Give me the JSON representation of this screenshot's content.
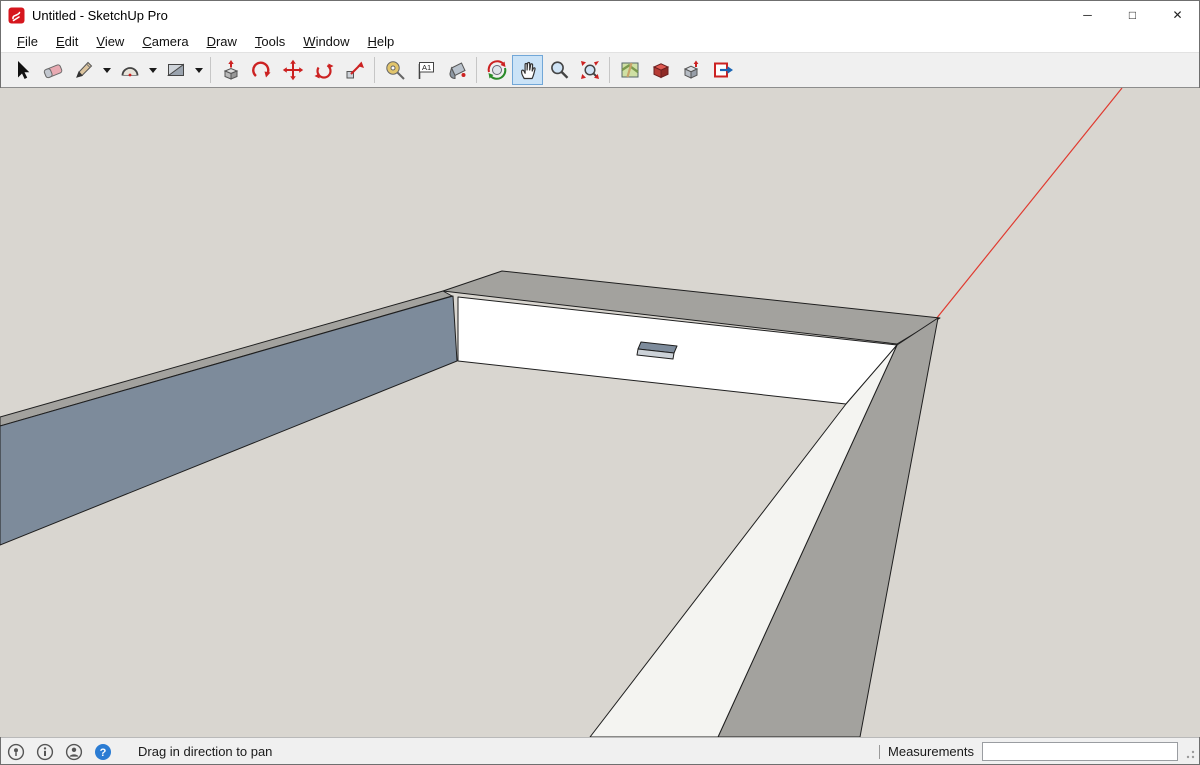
{
  "window": {
    "title": "Untitled - SketchUp Pro",
    "minimize_glyph": "─",
    "maximize_glyph": "□",
    "close_glyph": "✕"
  },
  "menu": {
    "items": [
      {
        "label": "File"
      },
      {
        "label": "Edit"
      },
      {
        "label": "View"
      },
      {
        "label": "Camera"
      },
      {
        "label": "Draw"
      },
      {
        "label": "Tools"
      },
      {
        "label": "Window"
      },
      {
        "label": "Help"
      }
    ]
  },
  "toolbar": {
    "text_tool_glyph": "A1",
    "tools": [
      {
        "id": "select",
        "label": "Select"
      },
      {
        "id": "eraser",
        "label": "Eraser"
      },
      {
        "id": "line",
        "label": "Line"
      },
      {
        "id": "line-options",
        "label": "Line Options"
      },
      {
        "id": "arc",
        "label": "2 Point Arc"
      },
      {
        "id": "arc-options",
        "label": "Arc Options"
      },
      {
        "id": "shapes",
        "label": "Rectangle"
      },
      {
        "id": "shapes-options",
        "label": "Shape Options"
      },
      {
        "id": "push-pull",
        "label": "Push/Pull"
      },
      {
        "id": "follow-me",
        "label": "Follow Me"
      },
      {
        "id": "move",
        "label": "Move"
      },
      {
        "id": "rotate",
        "label": "Rotate"
      },
      {
        "id": "scale",
        "label": "Scale"
      },
      {
        "id": "tape-measure",
        "label": "Tape Measure"
      },
      {
        "id": "text",
        "label": "Dimension"
      },
      {
        "id": "paint-bucket",
        "label": "Paint Bucket"
      },
      {
        "id": "orbit",
        "label": "Orbit"
      },
      {
        "id": "pan",
        "label": "Pan",
        "active": true
      },
      {
        "id": "zoom",
        "label": "Zoom"
      },
      {
        "id": "zoom-extents",
        "label": "Zoom Extents"
      },
      {
        "id": "add-location",
        "label": "Add Location"
      },
      {
        "id": "get-models",
        "label": "Get Models"
      },
      {
        "id": "share-model",
        "label": "Share Model"
      },
      {
        "id": "send-to-layout",
        "label": "Send to LayOut"
      }
    ]
  },
  "viewport": {
    "colors": {
      "background": "#d9d6d0",
      "front_face": "#ffffff",
      "side_face": "#f4f4f1",
      "back_face": "#7d8b9b",
      "top_face": "#a3a29e",
      "notch_lip": "#ccd2d8",
      "edge": "#1f1f1f",
      "axis_red": "#e03a2f"
    }
  },
  "statusbar": {
    "message": "Drag in direction to pan",
    "measurements_label": "Measurements",
    "measurements_value": "",
    "help_glyph": "?"
  }
}
